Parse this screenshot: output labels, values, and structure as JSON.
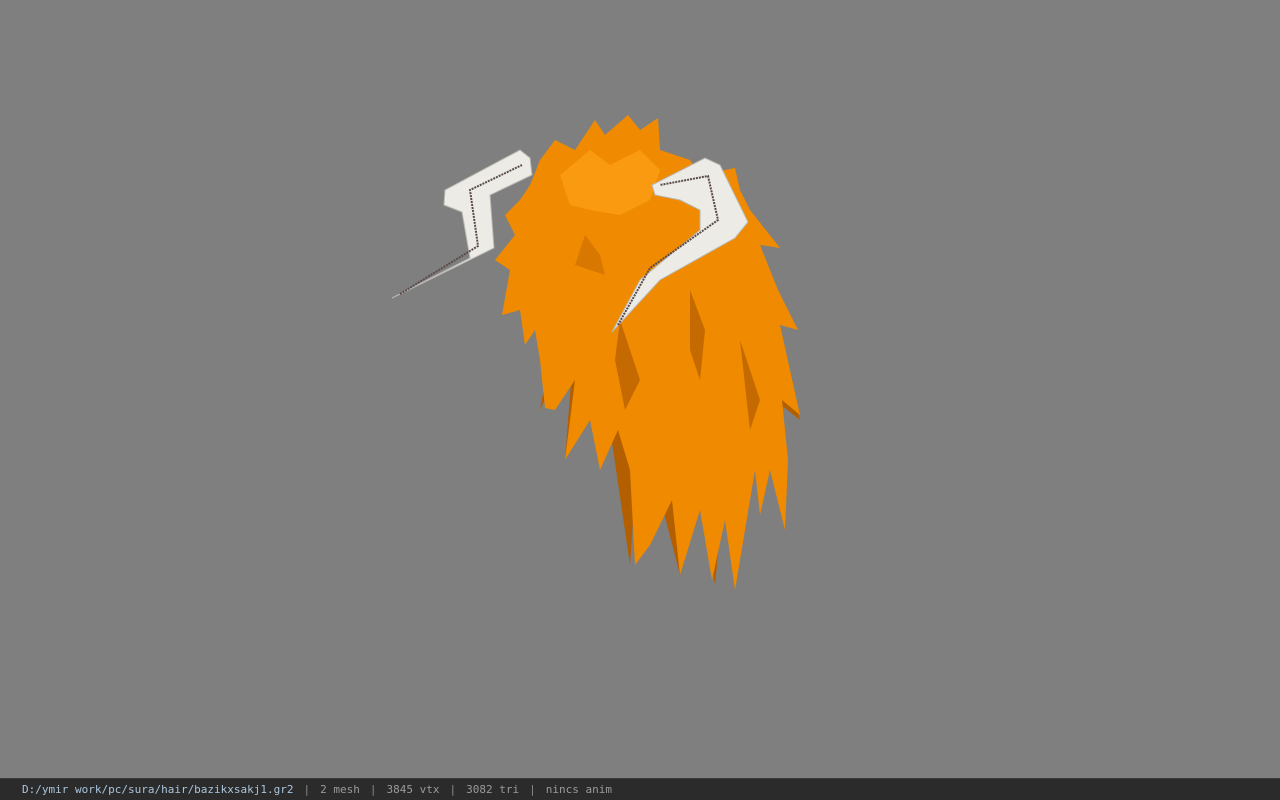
{
  "viewport": {
    "model": "hair-with-horns-model",
    "colors": {
      "background": "#7f7f7f",
      "hair": "#f08a00",
      "hair_shadow": "#b35f00",
      "horn": "#ecebe6",
      "horn_shadow": "#b9b8b2",
      "horn_stripe": "#5a4a4a"
    }
  },
  "status": {
    "file_path": "D:/ymir work/pc/sura/hair/bazikxsakj1.gr2",
    "separator": "|",
    "mesh_count": "2 mesh",
    "vertex_count": "3845 vtx",
    "triangle_count": "3082 tri",
    "animation": "nincs anim"
  }
}
